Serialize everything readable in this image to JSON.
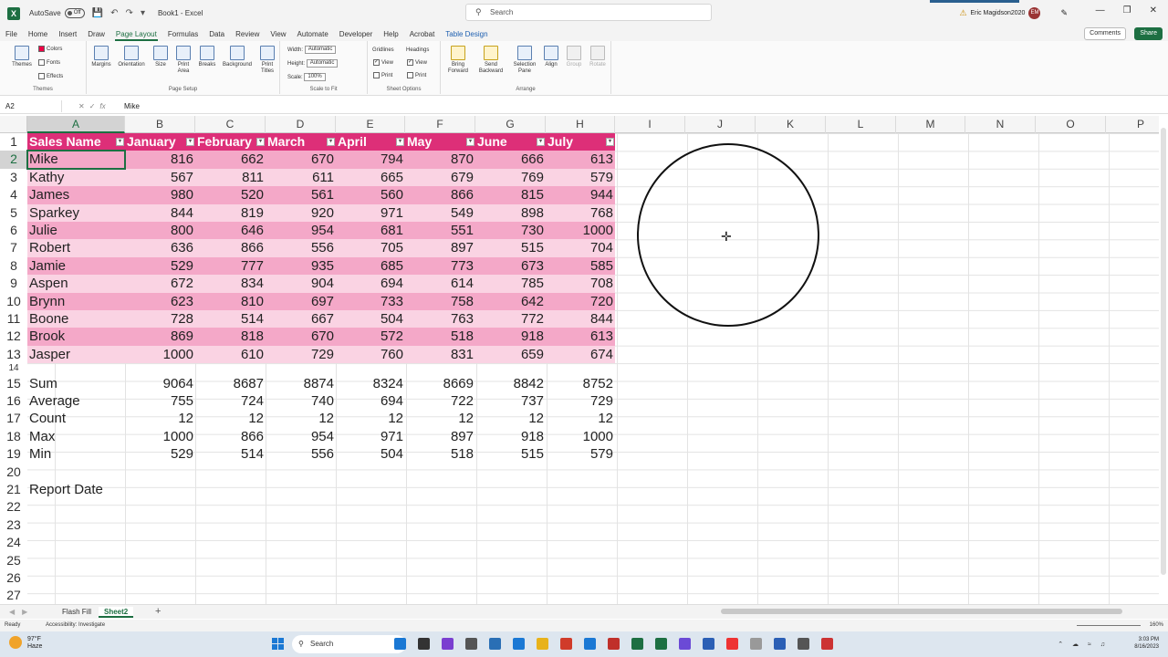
{
  "titlebar": {
    "autosave_label": "AutoSave",
    "autosave_state": "Off",
    "title": "Book1 - Excel",
    "search_placeholder": "Search",
    "user_name": "Eric Magidson2020",
    "user_initials": "EM"
  },
  "menu": {
    "tabs": [
      "File",
      "Home",
      "Insert",
      "Draw",
      "Page Layout",
      "Formulas",
      "Data",
      "Review",
      "View",
      "Automate",
      "Developer",
      "Help",
      "Acrobat",
      "Table Design"
    ],
    "active": "Page Layout",
    "comments": "Comments",
    "share": "Share"
  },
  "ribbon": {
    "themes": {
      "themes": "Themes",
      "colors": "Colors",
      "fonts": "Fonts",
      "effects": "Effects",
      "label": "Themes"
    },
    "page_setup": {
      "margins": "Margins",
      "orientation": "Orientation",
      "size": "Size",
      "print_area": "Print Area",
      "breaks": "Breaks",
      "background": "Background",
      "print_titles": "Print Titles",
      "label": "Page Setup"
    },
    "scale": {
      "width_label": "Width:",
      "width_val": "Automatic",
      "height_label": "Height:",
      "height_val": "Automatic",
      "scale_label": "Scale:",
      "scale_val": "100%",
      "label": "Scale to Fit"
    },
    "sheet_options": {
      "gridlines": "Gridlines",
      "headings": "Headings",
      "view": "View",
      "print": "Print",
      "label": "Sheet Options"
    },
    "arrange": {
      "bring_forward": "Bring Forward",
      "send_backward": "Send Backward",
      "selection_pane": "Selection Pane",
      "align": "Align",
      "group": "Group",
      "rotate": "Rotate",
      "label": "Arrange"
    }
  },
  "formula_bar": {
    "name_box": "A2",
    "fx": "fx",
    "value": "Mike"
  },
  "columns": [
    "A",
    "B",
    "C",
    "D",
    "E",
    "F",
    "G",
    "H",
    "I",
    "J",
    "K",
    "L",
    "M",
    "N",
    "O",
    "P"
  ],
  "rows": [
    "1",
    "2",
    "3",
    "4",
    "5",
    "6",
    "7",
    "8",
    "9",
    "10",
    "11",
    "12",
    "13",
    "14",
    "15",
    "16",
    "17",
    "18",
    "19",
    "20",
    "21",
    "22",
    "23",
    "24",
    "25",
    "26",
    "27"
  ],
  "table": {
    "headers": [
      "Sales Name",
      "January",
      "February",
      "March",
      "April",
      "May",
      "June",
      "July"
    ],
    "data": [
      [
        "Mike",
        "816",
        "662",
        "670",
        "794",
        "870",
        "666",
        "613"
      ],
      [
        "Kathy",
        "567",
        "811",
        "611",
        "665",
        "679",
        "769",
        "579"
      ],
      [
        "James",
        "980",
        "520",
        "561",
        "560",
        "866",
        "815",
        "944"
      ],
      [
        "Sparkey",
        "844",
        "819",
        "920",
        "971",
        "549",
        "898",
        "768"
      ],
      [
        "Julie",
        "800",
        "646",
        "954",
        "681",
        "551",
        "730",
        "1000"
      ],
      [
        "Robert",
        "636",
        "866",
        "556",
        "705",
        "897",
        "515",
        "704"
      ],
      [
        "Jamie",
        "529",
        "777",
        "935",
        "685",
        "773",
        "673",
        "585"
      ],
      [
        "Aspen",
        "672",
        "834",
        "904",
        "694",
        "614",
        "785",
        "708"
      ],
      [
        "Brynn",
        "623",
        "810",
        "697",
        "733",
        "758",
        "642",
        "720"
      ],
      [
        "Boone",
        "728",
        "514",
        "667",
        "504",
        "763",
        "772",
        "844"
      ],
      [
        "Brook",
        "869",
        "818",
        "670",
        "572",
        "518",
        "918",
        "613"
      ],
      [
        "Jasper",
        "1000",
        "610",
        "729",
        "760",
        "831",
        "659",
        "674"
      ]
    ]
  },
  "summary": [
    [
      "Sum",
      "9064",
      "8687",
      "8874",
      "8324",
      "8669",
      "8842",
      "8752"
    ],
    [
      "Average",
      "755",
      "724",
      "740",
      "694",
      "722",
      "737",
      "729"
    ],
    [
      "Count",
      "12",
      "12",
      "12",
      "12",
      "12",
      "12",
      "12"
    ],
    [
      "Max",
      "1000",
      "866",
      "954",
      "971",
      "897",
      "918",
      "1000"
    ],
    [
      "Min",
      "529",
      "514",
      "556",
      "504",
      "518",
      "515",
      "579"
    ]
  ],
  "report_date_label": "Report Date",
  "sheets": {
    "tabs": [
      "Flash Fill",
      "Sheet2"
    ],
    "active": "Sheet2",
    "add": "+"
  },
  "status": {
    "ready": "Ready",
    "accessibility": "Accessibility: Investigate",
    "zoom": "160%"
  },
  "taskbar": {
    "temp": "97°F",
    "weather": "Haze",
    "search": "Search",
    "time": "3:03 PM",
    "date": "8/16/2023"
  },
  "colors": {
    "header": "#dd2f78",
    "band_dark": "#f4a8c8",
    "band_light": "#fad3e3",
    "accent": "#1d6f42"
  }
}
